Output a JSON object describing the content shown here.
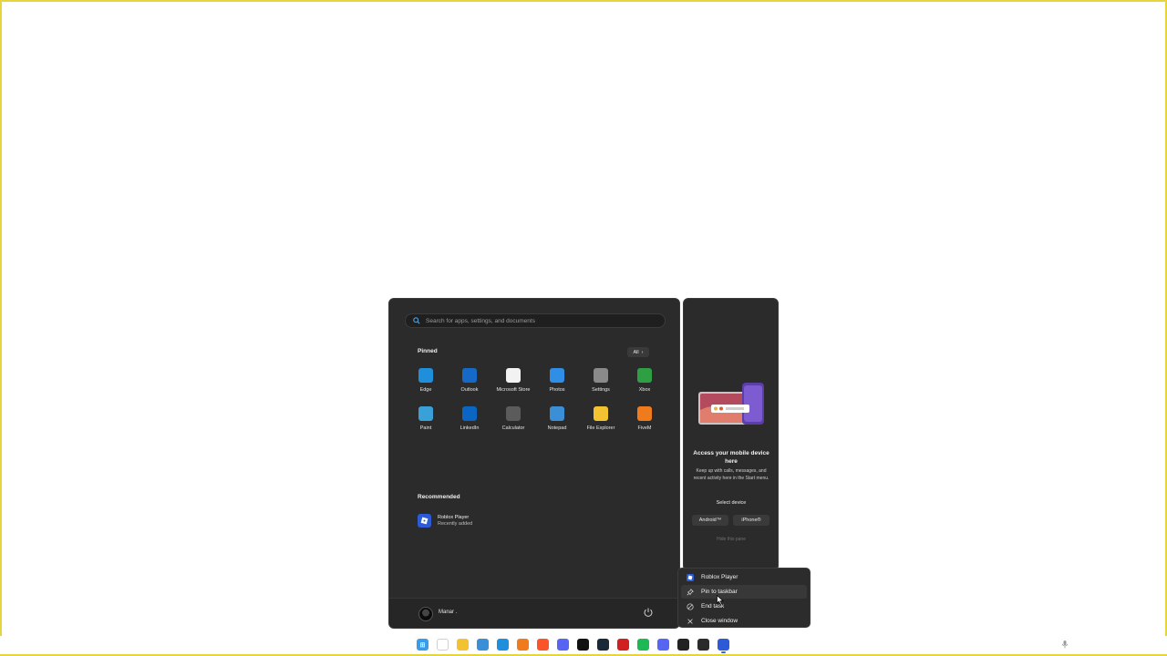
{
  "start_menu": {
    "search_placeholder": "Search for apps, settings, and documents",
    "pinned_title": "Pinned",
    "all_label": "All",
    "pinned_apps": [
      {
        "label": "Edge",
        "icon": "edge-icon",
        "color": "#1f8fdb"
      },
      {
        "label": "Outlook",
        "icon": "outlook-icon",
        "color": "#1569c7"
      },
      {
        "label": "Microsoft Store",
        "icon": "store-icon",
        "color": "#f2f2f2"
      },
      {
        "label": "Photos",
        "icon": "photos-icon",
        "color": "#2f8fe6"
      },
      {
        "label": "Settings",
        "icon": "gear-icon",
        "color": "#8a8a8a"
      },
      {
        "label": "Xbox",
        "icon": "xbox-icon",
        "color": "#2ea043"
      },
      {
        "label": "Paint",
        "icon": "paint-icon",
        "color": "#3aa0d8"
      },
      {
        "label": "LinkedIn",
        "icon": "linkedin-icon",
        "color": "#0a66c2"
      },
      {
        "label": "Calculator",
        "icon": "calculator-icon",
        "color": "#5b5b5b"
      },
      {
        "label": "Notepad",
        "icon": "notepad-icon",
        "color": "#3a8fd6"
      },
      {
        "label": "File Explorer",
        "icon": "folder-icon",
        "color": "#f2c230"
      },
      {
        "label": "FiveM",
        "icon": "fivem-icon",
        "color": "#f07b1d"
      }
    ],
    "recommended_title": "Recommended",
    "recommended": [
      {
        "name": "Roblox Player",
        "sub": "Recently added"
      }
    ],
    "user_name": "Manar ."
  },
  "phone_panel": {
    "heading": "Access your mobile device here",
    "description": "Keep up with calls, messages, and recent activity here in the Start menu.",
    "select_label": "Select device",
    "android_label": "Android™",
    "iphone_label": "iPhone®",
    "hide_label": "Hide this pane"
  },
  "context_menu": {
    "items": [
      {
        "label": "Roblox Player",
        "icon": "roblox-icon"
      },
      {
        "label": "Pin to taskbar",
        "icon": "pin-icon"
      },
      {
        "label": "End task",
        "icon": "end-task-icon"
      },
      {
        "label": "Close window",
        "icon": "close-icon"
      }
    ]
  },
  "taskbar": {
    "apps": [
      {
        "name": "start-icon",
        "color": "#3a9be8",
        "glyph": "⊞"
      },
      {
        "name": "search-icon",
        "color": "#ffffff",
        "glyph": ""
      },
      {
        "name": "folder-icon",
        "color": "#f2c230",
        "glyph": ""
      },
      {
        "name": "task-view-icon",
        "color": "#3a8fd6",
        "glyph": ""
      },
      {
        "name": "edge-icon",
        "color": "#1f8fdb",
        "glyph": ""
      },
      {
        "name": "fivem-icon",
        "color": "#f07b1d",
        "glyph": ""
      },
      {
        "name": "brave-icon",
        "color": "#fb542b",
        "glyph": ""
      },
      {
        "name": "discord-icon",
        "color": "#5865f2",
        "glyph": ""
      },
      {
        "name": "epic-games-icon",
        "color": "#111111",
        "glyph": ""
      },
      {
        "name": "steam-icon",
        "color": "#1b2838",
        "glyph": ""
      },
      {
        "name": "game-launcher-icon",
        "color": "#d02020",
        "glyph": ""
      },
      {
        "name": "spotify-icon",
        "color": "#1db954",
        "glyph": ""
      },
      {
        "name": "discord-2-icon",
        "color": "#5865f2",
        "glyph": ""
      },
      {
        "name": "chatgpt-icon",
        "color": "#222222",
        "glyph": ""
      },
      {
        "name": "app-icon",
        "color": "#2b2b2b",
        "glyph": ""
      },
      {
        "name": "roblox-icon",
        "color": "#2d5bd7",
        "glyph": ""
      }
    ]
  }
}
